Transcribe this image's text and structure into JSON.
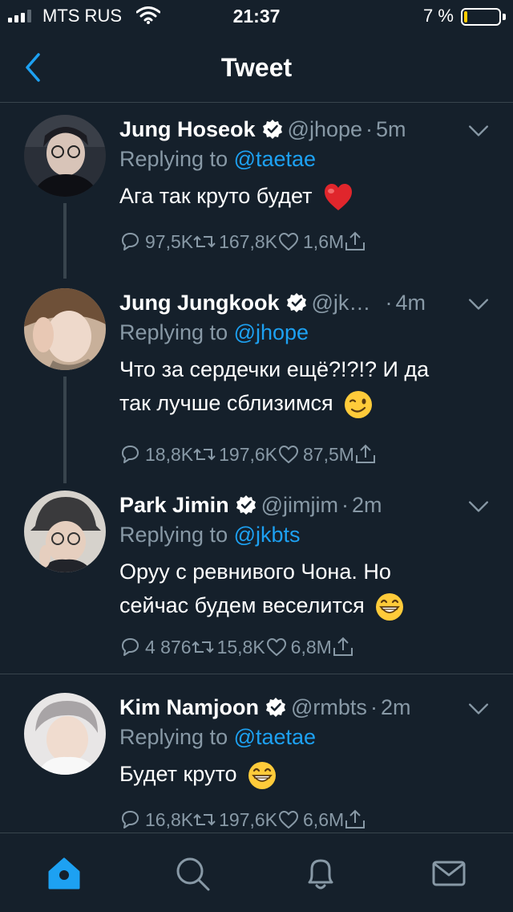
{
  "status_bar": {
    "carrier": "MTS RUS",
    "time": "21:37",
    "battery_percent": "7 %",
    "battery_level": 0.07,
    "signal_bars": 3,
    "icons": [
      "signal-icon",
      "wifi-icon",
      "battery-icon"
    ]
  },
  "nav": {
    "title": "Tweet",
    "back_icon": "chevron-left-icon"
  },
  "colors": {
    "background": "#15202b",
    "accent": "#1da1f2",
    "muted": "#8899a6",
    "divider": "#38444d",
    "battery_low": "#ffcc00"
  },
  "tweets": [
    {
      "name": "Jung Hoseok",
      "handle": "@jhope",
      "dot": "·",
      "time": "5m",
      "reply_prefix": "Replying to ",
      "reply_to": "@taetae",
      "text": "Ага так круто будет",
      "emoji": "red-heart",
      "replies": "97,5K",
      "retweets": "167,8K",
      "likes": "1,6M"
    },
    {
      "name": "Jung Jungkook",
      "handle": "@jk…",
      "dot": "·",
      "time": "4m",
      "reply_prefix": "Replying to ",
      "reply_to": "@jhope",
      "text_line1": "Что за сердечки ещё?!?!? И да",
      "text_line2": "так лучше сблизимся",
      "emoji": "winking-face",
      "replies": "18,8K",
      "retweets": "197,6K",
      "likes": "87,5M"
    },
    {
      "name": "Park Jimin",
      "handle": "@jimjim",
      "dot": "·",
      "time": "2m",
      "reply_prefix": "Replying to ",
      "reply_to": "@jkbts",
      "text_line1": "Оруу с ревнивого Чона. Но",
      "text_line2": "сейчас будем веселится",
      "emoji": "grinning-face",
      "replies": "4 876",
      "retweets": "15,8K",
      "likes": "6,8M"
    },
    {
      "name": "Kim Namjoon",
      "handle": "@rmbts",
      "dot": "·",
      "time": "2m",
      "reply_prefix": "Replying to ",
      "reply_to": "@taetae",
      "text": "Будет круто",
      "emoji": "grinning-face",
      "replies": "16,8K",
      "retweets": "197,6K",
      "likes": "6,6M"
    }
  ],
  "tab_bar": {
    "items": [
      "home-icon",
      "search-icon",
      "notifications-icon",
      "messages-icon"
    ],
    "active": "home-icon"
  }
}
